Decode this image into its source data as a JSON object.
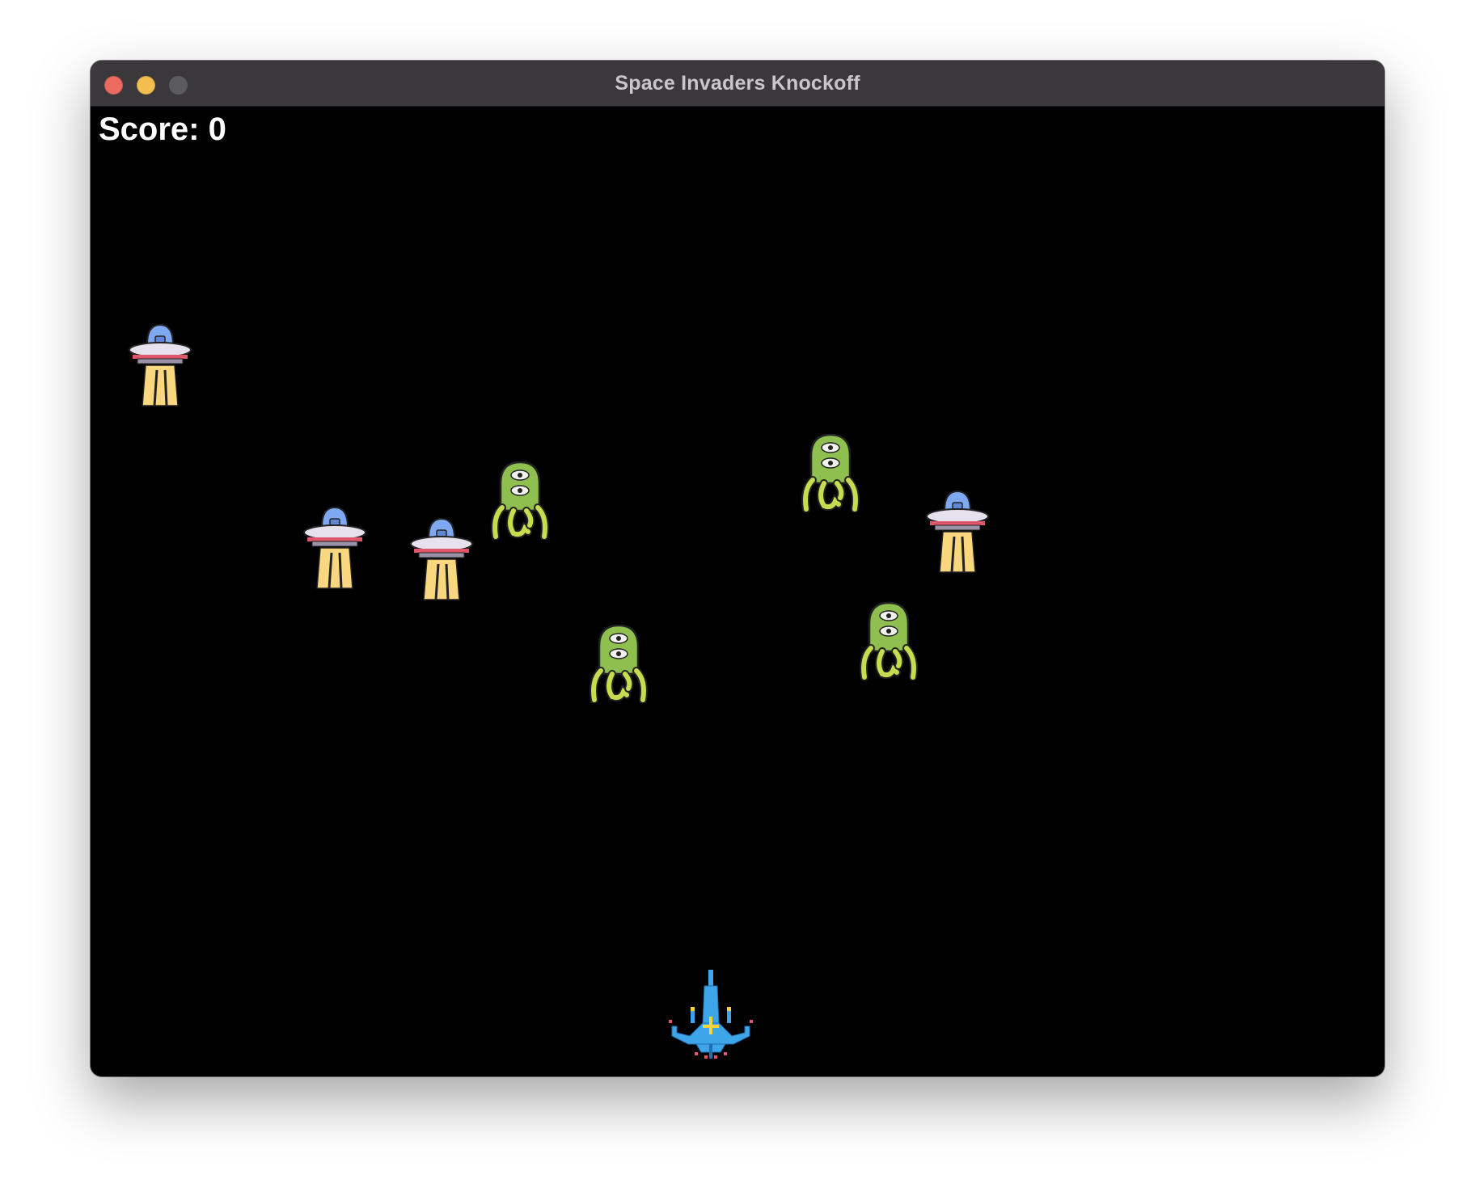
{
  "window": {
    "title": "Space Invaders Knockoff"
  },
  "hud": {
    "score_label": "Score: 0",
    "score": 0
  },
  "colors": {
    "background": "#000000",
    "titlebar": "#3a383b",
    "close": "#ed6a5e",
    "minimize": "#f4be4f",
    "zoom": "#5c5b5e",
    "ufo_dome": "#7fa8f2",
    "ufo_beam": "#f9d77e",
    "alien_body": "#8fbf4f",
    "player_ship": "#3ea6e8"
  },
  "enemies": {
    "ufos": [
      {
        "type": "ufo-icon"
      },
      {
        "type": "ufo-icon"
      },
      {
        "type": "ufo-icon"
      },
      {
        "type": "ufo-icon"
      }
    ],
    "aliens": [
      {
        "type": "alien-icon"
      },
      {
        "type": "alien-icon"
      },
      {
        "type": "alien-icon"
      },
      {
        "type": "alien-icon"
      }
    ]
  },
  "player": {
    "type": "spaceship-icon"
  }
}
